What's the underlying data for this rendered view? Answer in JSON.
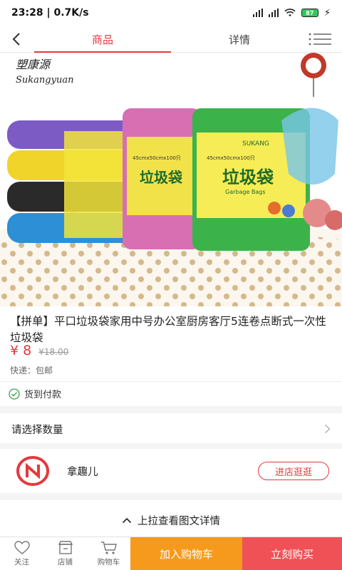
{
  "status_bar": {
    "time": "23:28",
    "network_speed": "0.7K/s",
    "battery_level": "87"
  },
  "nav": {
    "tabs": [
      {
        "label": "商品",
        "active": true
      },
      {
        "label": "详情",
        "active": false
      }
    ]
  },
  "product_image": {
    "brand_cn": "塑康源",
    "brand_en": "Sukangyuan",
    "bag_label": "垃圾袋",
    "bag_sublabel": "Garbage Bags",
    "bag_size": "45cmx50cmx100只",
    "bag_brand": "SUKANG"
  },
  "product": {
    "title": "【拼单】平口垃圾袋家用中号办公室厨房客厅5连卷点断式一次性垃圾袋",
    "price": "¥ 8",
    "original_price": "¥18.00",
    "shipping": "快递：包邮",
    "cod_label": "货到付款"
  },
  "quantity": {
    "label": "请选择数量"
  },
  "store": {
    "name": "拿趣儿",
    "visit_label": "进店逛逛"
  },
  "pull_up": {
    "label": "上拉查看图文详情"
  },
  "bottom_bar": {
    "favorite": "关注",
    "store": "店铺",
    "cart": "购物车",
    "add_to_cart": "加入购物车",
    "buy_now": "立刻购买"
  },
  "colors": {
    "accent": "#e4393c",
    "add_cart_bg": "#f59a1c",
    "buy_now_bg": "#f05156",
    "battery": "#34c759"
  }
}
